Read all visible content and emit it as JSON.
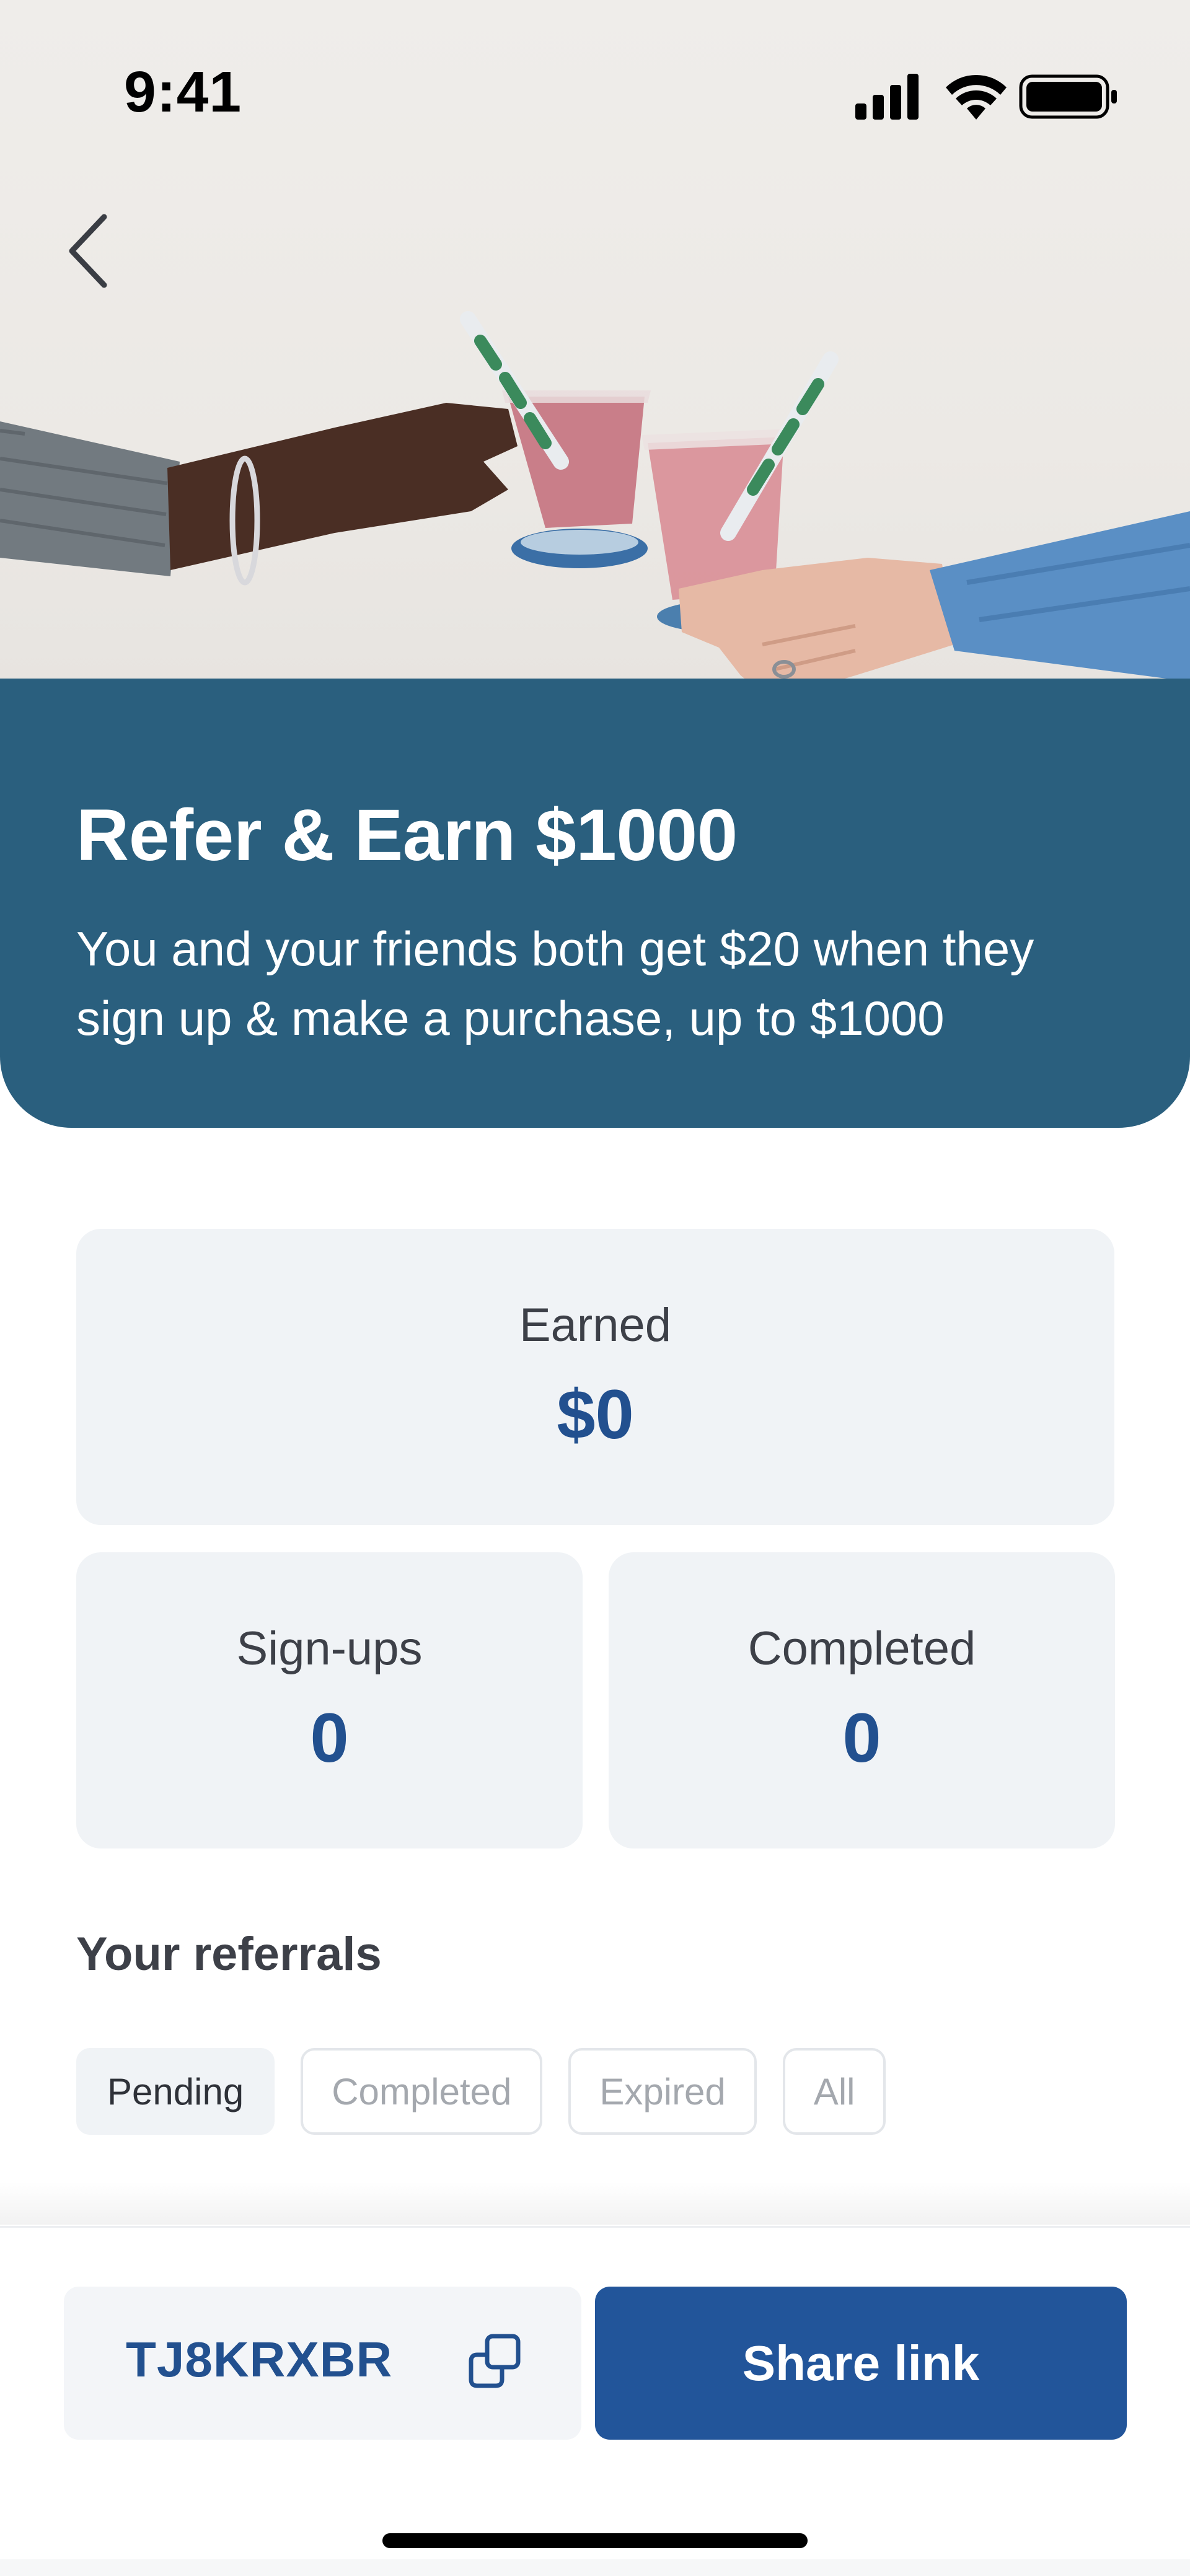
{
  "status_bar": {
    "time": "9:41",
    "icons": [
      "signal-icon",
      "wifi-icon",
      "battery-icon"
    ]
  },
  "nav": {
    "back_icon": "chevron-left-icon"
  },
  "banner": {
    "title": "Refer & Earn $1000",
    "description": "You and your friends both get $20 when they sign up & make a purchase, up to $1000",
    "background_color": "#2a5f7e"
  },
  "stats": {
    "earned": {
      "label": "Earned",
      "value": "$0"
    },
    "signups": {
      "label": "Sign-ups",
      "value": "0"
    },
    "completed": {
      "label": "Completed",
      "value": "0"
    }
  },
  "referrals": {
    "title": "Your referrals",
    "filters": [
      {
        "label": "Pending",
        "active": true
      },
      {
        "label": "Completed",
        "active": false
      },
      {
        "label": "Expired",
        "active": false
      },
      {
        "label": "All",
        "active": false
      }
    ]
  },
  "footer": {
    "referral_code": "TJ8KRXBR",
    "copy_icon": "copy-icon",
    "share_label": "Share link",
    "accent_color": "#22559a"
  }
}
